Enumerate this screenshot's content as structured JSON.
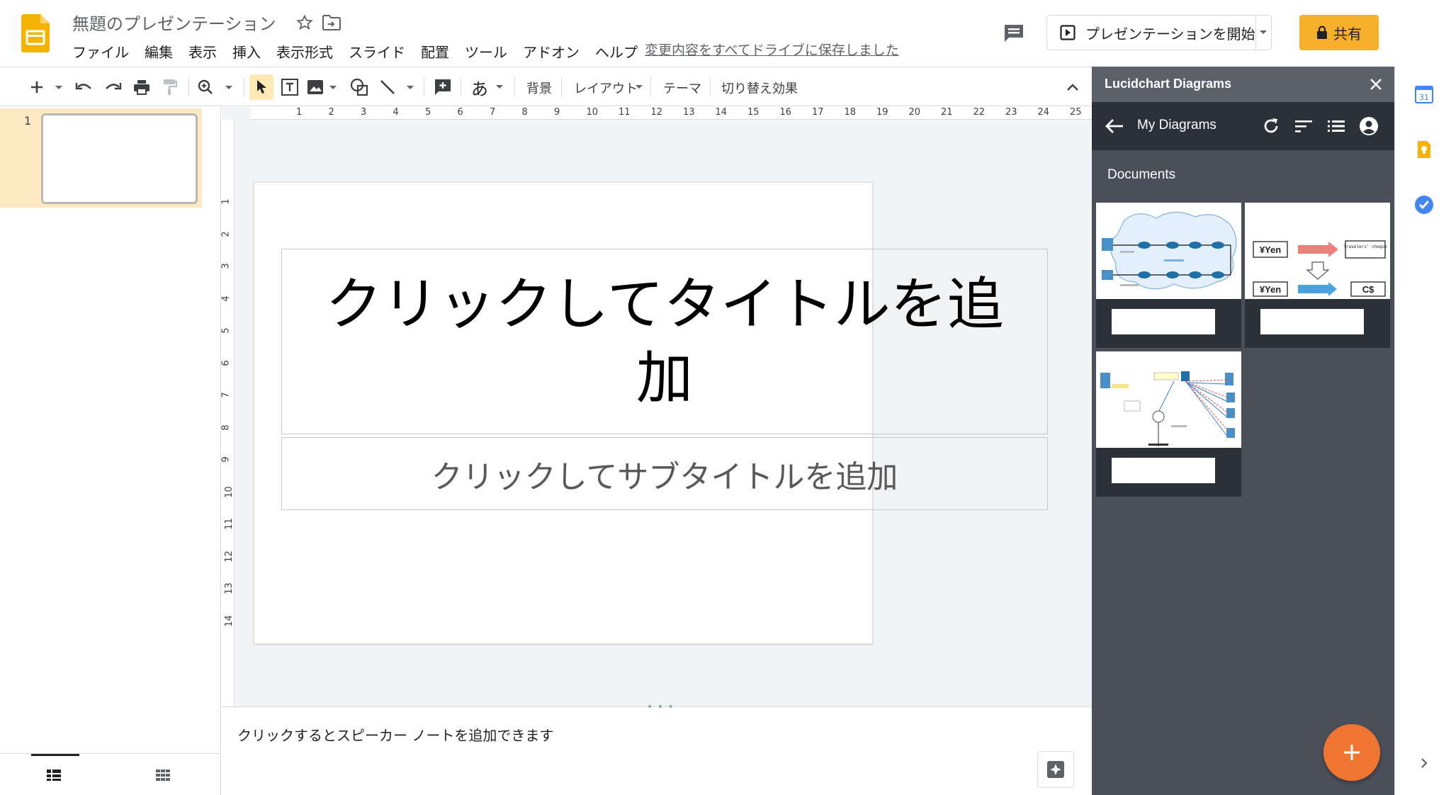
{
  "header": {
    "doc_title": "無題のプレゼンテーション",
    "save_status": "変更内容をすべてドライブに保存しました",
    "present_label": "プレゼンテーションを開始",
    "share_label": "共有",
    "colors": {
      "slides_yellow": "#f4b400",
      "share_bg": "#f6b02b"
    }
  },
  "menu": [
    {
      "label": "ファイル"
    },
    {
      "label": "編集"
    },
    {
      "label": "表示"
    },
    {
      "label": "挿入"
    },
    {
      "label": "表示形式"
    },
    {
      "label": "スライド"
    },
    {
      "label": "配置"
    },
    {
      "label": "ツール"
    },
    {
      "label": "アドオン"
    },
    {
      "label": "ヘルプ"
    }
  ],
  "toolbar": {
    "text_style_glyph": "あ",
    "background": "背景",
    "layout": "レイアウト",
    "theme": "テーマ",
    "transition": "切り替え効果"
  },
  "filmstrip": {
    "slides": [
      {
        "number": "1"
      }
    ]
  },
  "rulers": {
    "horizontal": [
      "1",
      "2",
      "3",
      "4",
      "5",
      "6",
      "7",
      "8",
      "9",
      "10",
      "11",
      "12",
      "13",
      "14",
      "15",
      "16",
      "17",
      "18",
      "19",
      "20",
      "21",
      "22",
      "23",
      "24",
      "25"
    ],
    "vertical": [
      "1",
      "2",
      "3",
      "4",
      "5",
      "6",
      "7",
      "8",
      "9",
      "10",
      "11",
      "12",
      "13",
      "14"
    ]
  },
  "slide": {
    "title_placeholder": "クリックしてタイトルを追加",
    "subtitle_placeholder": "クリックしてサブタイトルを追加"
  },
  "notes": {
    "placeholder": "クリックするとスピーカー ノートを追加できます"
  },
  "lucidchart": {
    "panel_title": "Lucidchart Diagrams",
    "nav_title": "My Diagrams",
    "section_label": "Documents",
    "thumb2": {
      "yen_top": "¥Yen",
      "yen_bottom": "¥Yen",
      "travelers": "Travelers' cheque",
      "cad": "C$"
    },
    "colors": {
      "panel_bg": "#4a4f5a",
      "nav_bg": "#2c3038",
      "fab": "#ef7530"
    }
  },
  "side_rail": {
    "calendar_day": "31"
  }
}
